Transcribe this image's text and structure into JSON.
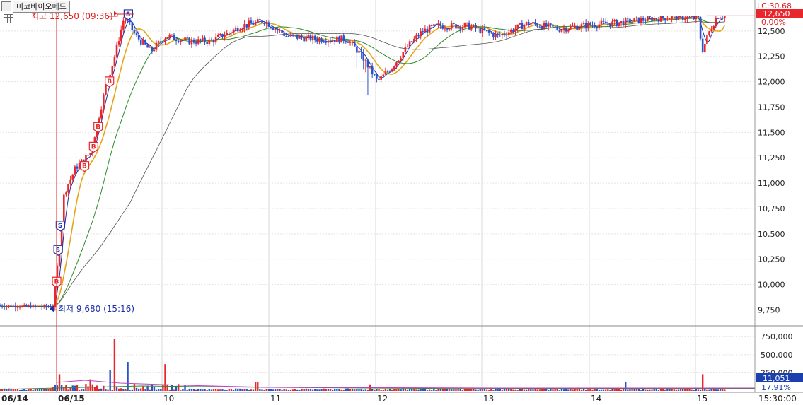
{
  "title": {
    "stock_name": "미코바이오메드"
  },
  "annotations": {
    "high_label": "최고 12,650 (09:36)",
    "low_label": "최저 9,680 (15:16)"
  },
  "right_panel": {
    "lc_label": "LC:30.68",
    "price_box": "12,650",
    "change_pct": "0.00%",
    "volume_box": "11,051",
    "volume_pct": "17.91%"
  },
  "colors": {
    "up": "#e8262c",
    "down": "#2a52c9",
    "ma5": "#1c2fa8",
    "ma10": "#e8a316",
    "ma20": "#2c8a2c",
    "ma60": "#555555",
    "marker": "#e8262c"
  },
  "chart_data": {
    "type": "candlestick",
    "title": "",
    "price_axis": {
      "ticks": [
        9750,
        10000,
        10250,
        10500,
        10750,
        11000,
        11250,
        11500,
        11750,
        12000,
        12250,
        12500
      ],
      "range": [
        9600,
        12750
      ]
    },
    "volume_axis": {
      "ticks": [
        250000,
        500000,
        750000
      ],
      "range": [
        0,
        850000
      ]
    },
    "x_labels": [
      "06/14",
      "06/15",
      "10",
      "11",
      "12",
      "13",
      "14",
      "15",
      "15:30:00"
    ],
    "high": {
      "price": 12650,
      "time": "09:36"
    },
    "low": {
      "price": 9680,
      "time": "15:16"
    },
    "last_close": 12650,
    "approx_close_path": [
      {
        "t": 0.0,
        "p": 9790
      },
      {
        "t": 0.07,
        "p": 9780
      },
      {
        "t": 0.075,
        "p": 10100
      },
      {
        "t": 0.085,
        "p": 10900
      },
      {
        "t": 0.1,
        "p": 11150
      },
      {
        "t": 0.12,
        "p": 11300
      },
      {
        "t": 0.14,
        "p": 11950
      },
      {
        "t": 0.15,
        "p": 12200
      },
      {
        "t": 0.165,
        "p": 12650
      },
      {
        "t": 0.18,
        "p": 12450
      },
      {
        "t": 0.2,
        "p": 12300
      },
      {
        "t": 0.22,
        "p": 12450
      },
      {
        "t": 0.25,
        "p": 12400
      },
      {
        "t": 0.28,
        "p": 12400
      },
      {
        "t": 0.32,
        "p": 12550
      },
      {
        "t": 0.35,
        "p": 12600
      },
      {
        "t": 0.38,
        "p": 12450
      },
      {
        "t": 0.42,
        "p": 12420
      },
      {
        "t": 0.46,
        "p": 12420
      },
      {
        "t": 0.48,
        "p": 12250
      },
      {
        "t": 0.5,
        "p": 12000
      },
      {
        "t": 0.52,
        "p": 12150
      },
      {
        "t": 0.54,
        "p": 12350
      },
      {
        "t": 0.56,
        "p": 12500
      },
      {
        "t": 0.58,
        "p": 12550
      },
      {
        "t": 0.62,
        "p": 12550
      },
      {
        "t": 0.66,
        "p": 12450
      },
      {
        "t": 0.7,
        "p": 12580
      },
      {
        "t": 0.74,
        "p": 12520
      },
      {
        "t": 0.78,
        "p": 12560
      },
      {
        "t": 0.82,
        "p": 12580
      },
      {
        "t": 0.86,
        "p": 12620
      },
      {
        "t": 0.9,
        "p": 12640
      },
      {
        "t": 0.925,
        "p": 12620
      },
      {
        "t": 0.93,
        "p": 12300
      },
      {
        "t": 0.94,
        "p": 12500
      },
      {
        "t": 0.95,
        "p": 12650
      }
    ],
    "volume_spikes": [
      {
        "t": 0.08,
        "v": 230000
      },
      {
        "t": 0.12,
        "v": 160000
      },
      {
        "t": 0.145,
        "v": 290000
      },
      {
        "t": 0.152,
        "v": 720000
      },
      {
        "t": 0.168,
        "v": 400000
      },
      {
        "t": 0.22,
        "v": 370000
      },
      {
        "t": 0.34,
        "v": 120000
      },
      {
        "t": 0.49,
        "v": 90000
      },
      {
        "t": 0.83,
        "v": 120000
      },
      {
        "t": 0.93,
        "v": 230000
      }
    ],
    "buy_sell_markers": [
      {
        "t": 0.075,
        "label": "B"
      },
      {
        "t": 0.077,
        "label": "S"
      },
      {
        "t": 0.08,
        "label": "S"
      },
      {
        "t": 0.112,
        "label": "B"
      },
      {
        "t": 0.124,
        "label": "B"
      },
      {
        "t": 0.13,
        "label": "B"
      },
      {
        "t": 0.145,
        "label": "B"
      },
      {
        "t": 0.17,
        "label": "S"
      }
    ]
  }
}
